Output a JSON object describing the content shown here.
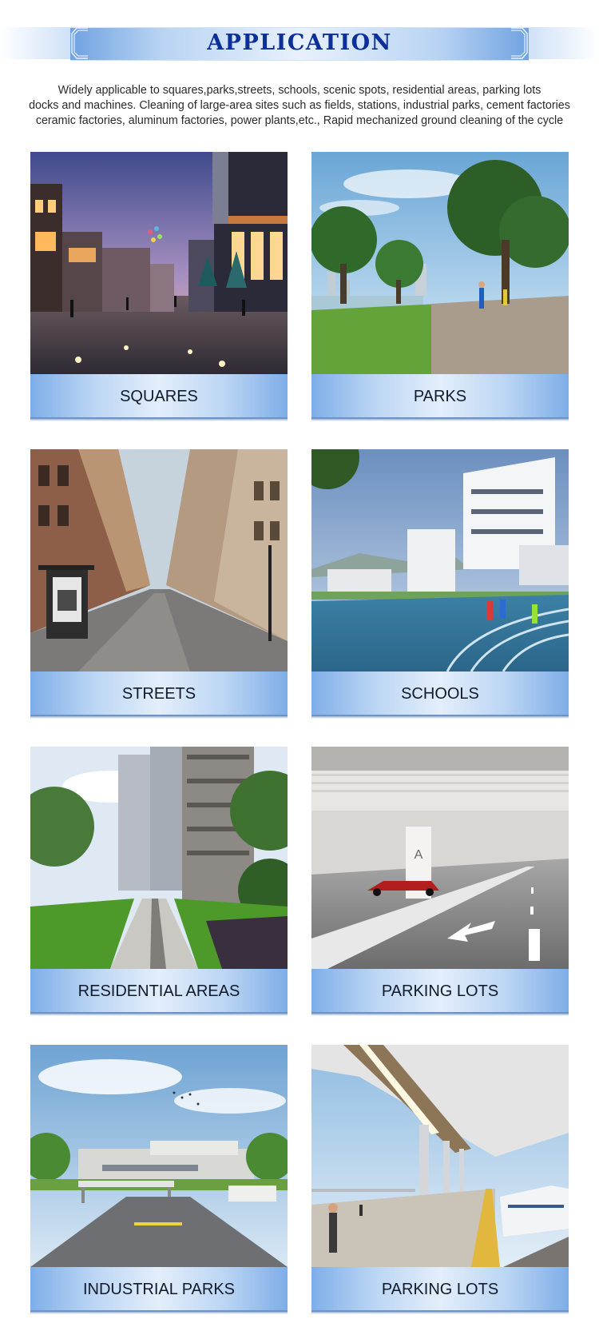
{
  "header": {
    "title": "APPLICATION"
  },
  "description": {
    "lines": [
      "Widely applicable to squares,parks,streets, schools, scenic spots, residential areas, parking lots",
      "docks and machines. Cleaning of large-area sites such as fields, stations,  industrial parks, cement factories",
      "ceramic factories, aluminum factories, power plants,etc., Rapid mechanized ground cleaning of the cycle"
    ]
  },
  "cards": [
    {
      "label": "SQUARES"
    },
    {
      "label": "PARKS"
    },
    {
      "label": "STREETS"
    },
    {
      "label": "SCHOOLS"
    },
    {
      "label": "RESIDENTIAL AREAS"
    },
    {
      "label": "PARKING LOTS"
    },
    {
      "label": "INDUSTRIAL PARKS"
    },
    {
      "label": "PARKING LOTS"
    }
  ],
  "colors": {
    "title": "#0c2f98",
    "banner_light": "#e8f1fc",
    "banner_dark": "#6fa2e1",
    "label_band_edge": "#7eaee8",
    "label_band_center": "#e3eefb",
    "label_text": "#111a2a"
  }
}
